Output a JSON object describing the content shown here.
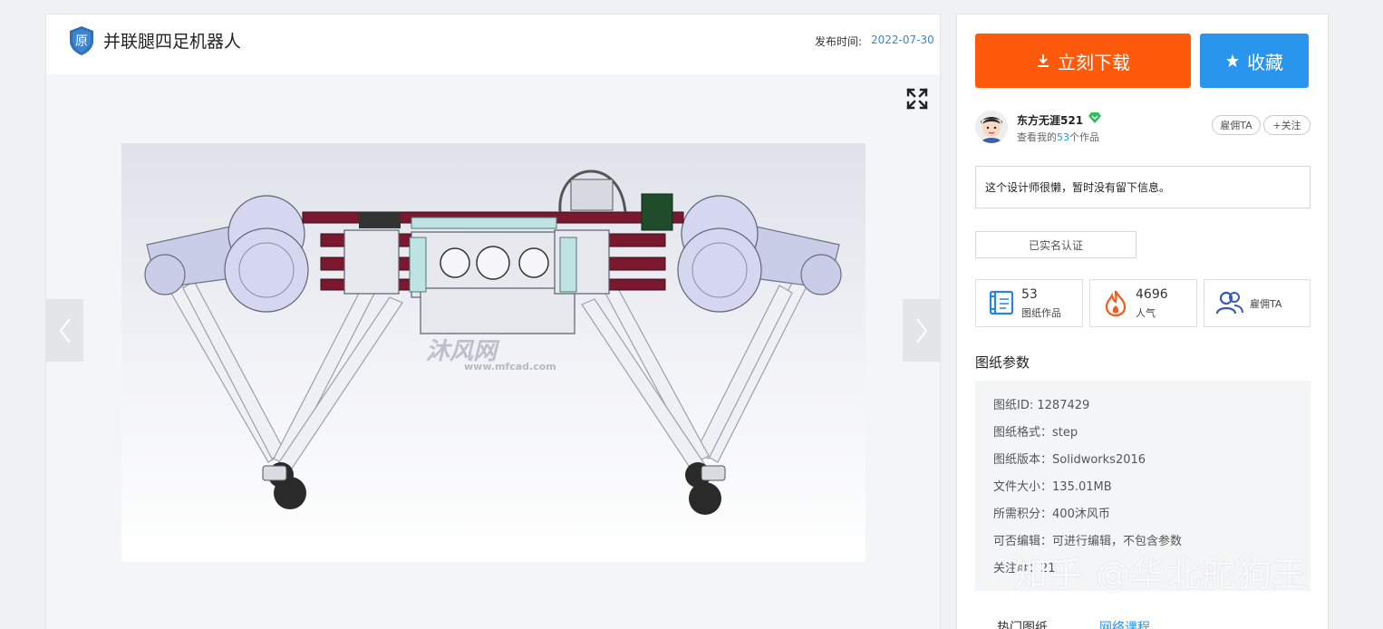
{
  "header": {
    "badge_text": "原",
    "title": "并联腿四足机器人",
    "publish_label": "发布时间:",
    "publish_date": "2022-07-30"
  },
  "viewer": {
    "watermark_logo": "沐风网",
    "watermark_url": "www.mfcad.com"
  },
  "actions": {
    "download_label": "立刻下载",
    "favorite_label": "收藏"
  },
  "author": {
    "name": "东方无涯521",
    "works_prefix": "查看我的",
    "works_count": "53",
    "works_suffix": "个作品",
    "hire_label": "雇佣TA",
    "follow_label": "+关注",
    "bio": "这个设计师很懒，暂时没有留下信息。",
    "verified_label": "已实名认证"
  },
  "stats": [
    {
      "value": "53",
      "label": "图纸作品",
      "icon": "drawing-scroll-icon"
    },
    {
      "value": "4696",
      "label": "人气",
      "icon": "flame-icon"
    },
    {
      "value": "",
      "label": "雇佣TA",
      "icon": "people-icon"
    }
  ],
  "params": {
    "title": "图纸参数",
    "rows": [
      {
        "label": "图纸ID",
        "value": "1287429"
      },
      {
        "label": "图纸格式",
        "value": "step"
      },
      {
        "label": "图纸版本",
        "value": "Solidworks2016"
      },
      {
        "label": "文件大小",
        "value": "135.01MB"
      },
      {
        "label": "所需积分",
        "value": "400沐风币"
      },
      {
        "label": "可否编辑",
        "value": "可进行编辑，不包含参数"
      },
      {
        "label": "关注度",
        "value": "21"
      }
    ]
  },
  "bottom_tabs": [
    "热门图纸",
    "网络课程"
  ],
  "overlay_watermark": "知乎 @华北舵狗王",
  "colors": {
    "download": "#ff5a0c",
    "favorite": "#2a95ec",
    "link": "#3a86c9",
    "robot_frame": "#7a1830"
  }
}
